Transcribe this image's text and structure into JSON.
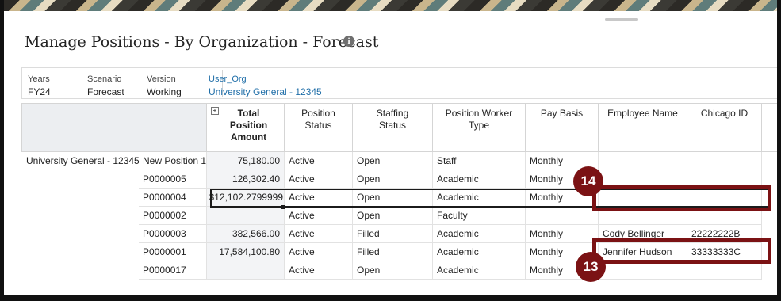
{
  "page": {
    "title": "Manage Positions - By Organization - Forecast",
    "info_icon": "info-icon"
  },
  "pov": [
    {
      "label": "Years",
      "value": "FY24"
    },
    {
      "label": "Scenario",
      "value": "Forecast"
    },
    {
      "label": "Version",
      "value": "Working"
    },
    {
      "label": "User_Org",
      "value": "University General - 12345"
    }
  ],
  "columns": [
    {
      "label": "Total Position Amount",
      "has_expand": true
    },
    {
      "label": "Position Status"
    },
    {
      "label": "Staffing Status"
    },
    {
      "label": "Position Worker Type"
    },
    {
      "label": "Pay Basis"
    },
    {
      "label": "Employee Name"
    },
    {
      "label": "Chicago ID"
    }
  ],
  "org_label": "University General - 12345",
  "rows": [
    {
      "position": "New Position 1",
      "amount": "75,180.00",
      "pos_status": "Active",
      "staffing": "Open",
      "worker_type": "Staff",
      "pay_basis": "Monthly",
      "employee": "",
      "chicago_id": ""
    },
    {
      "position": "P0000005",
      "amount": "126,302.40",
      "pos_status": "Active",
      "staffing": "Open",
      "worker_type": "Academic",
      "pay_basis": "Monthly",
      "employee": "",
      "chicago_id": ""
    },
    {
      "position": "P0000004",
      "amount": "312,102.2799999",
      "pos_status": "Active",
      "staffing": "Open",
      "worker_type": "Academic",
      "pay_basis": "Monthly",
      "employee": "",
      "chicago_id": ""
    },
    {
      "position": "P0000002",
      "amount": "",
      "pos_status": "Active",
      "staffing": "Open",
      "worker_type": "Faculty",
      "pay_basis": "",
      "employee": "",
      "chicago_id": ""
    },
    {
      "position": "P0000003",
      "amount": "382,566.00",
      "pos_status": "Active",
      "staffing": "Filled",
      "worker_type": "Academic",
      "pay_basis": "Monthly",
      "employee": "Cody Bellinger",
      "chicago_id": "22222222B"
    },
    {
      "position": "P0000001",
      "amount": "17,584,100.80",
      "pos_status": "Active",
      "staffing": "Filled",
      "worker_type": "Academic",
      "pay_basis": "Monthly",
      "employee": "Jennifer Hudson",
      "chicago_id": "33333333C"
    },
    {
      "position": "P0000017",
      "amount": "",
      "pos_status": "Active",
      "staffing": "Open",
      "worker_type": "Academic",
      "pay_basis": "Monthly",
      "employee": "",
      "chicago_id": ""
    }
  ],
  "callouts": {
    "first": {
      "number": "14"
    },
    "second": {
      "number": "13"
    }
  },
  "colors": {
    "callout": "#7b1214",
    "link": "#1f6ea8",
    "header_shade": "#eceef1"
  }
}
